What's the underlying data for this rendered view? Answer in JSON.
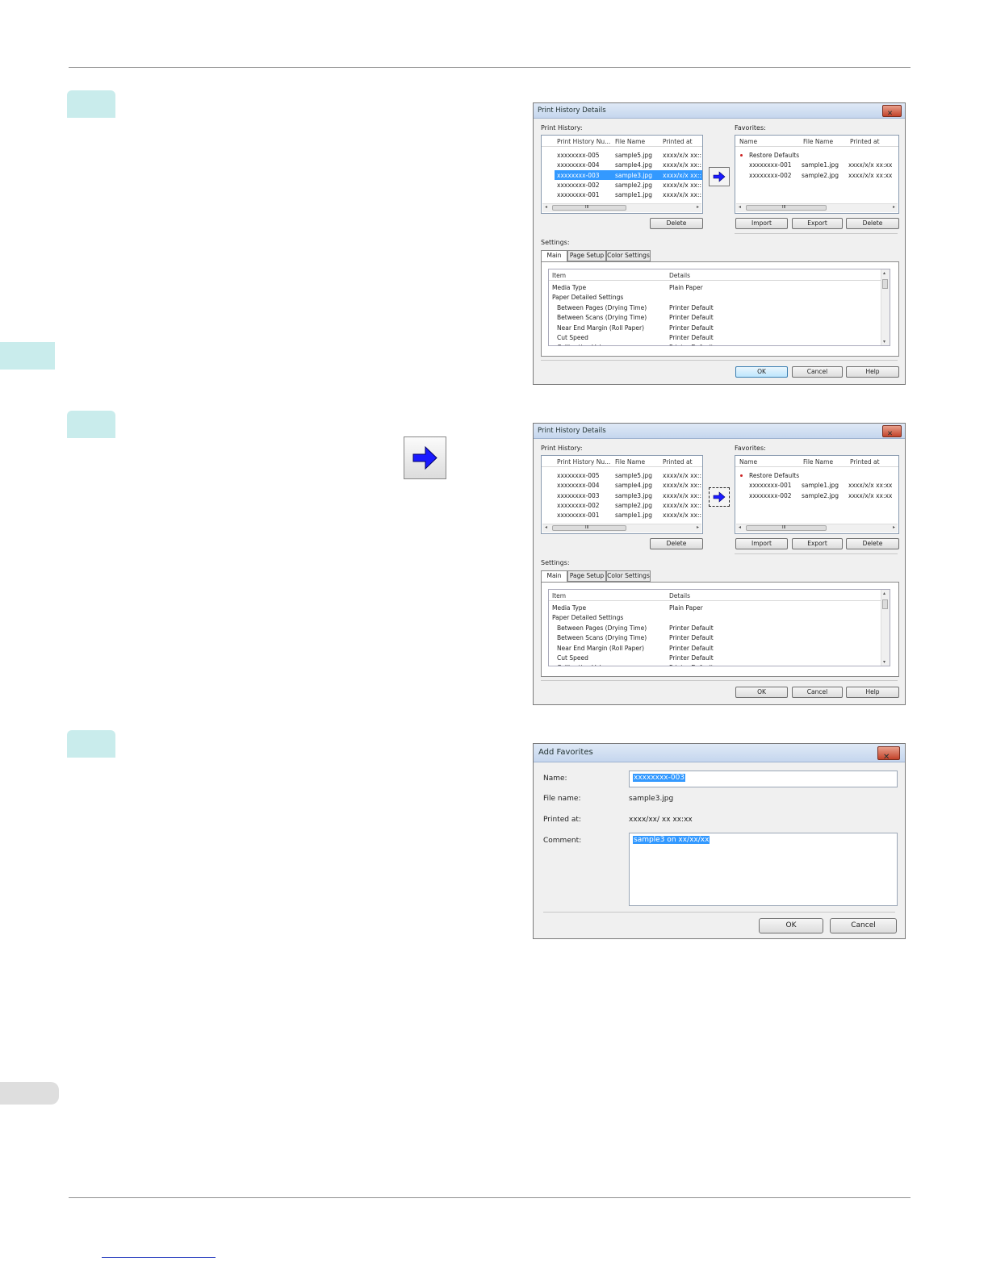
{
  "dialog1": {
    "title": "Print History Details",
    "print_history_label": "Print History:",
    "favorites_label": "Favorites:",
    "settings_label": "Settings:",
    "history_columns": [
      "Print History Nu...",
      "File Name",
      "Printed at"
    ],
    "history_rows": [
      [
        "xxxxxxxx-005",
        "sample5.jpg",
        "xxxx/x/x xx::"
      ],
      [
        "xxxxxxxx-004",
        "sample4.jpg",
        "xxxx/x/x xx::"
      ],
      [
        "xxxxxxxx-003",
        "sample3.jpg",
        "xxxx/x/x xx::"
      ],
      [
        "xxxxxxxx-002",
        "sample2.jpg",
        "xxxx/x/x xx::"
      ],
      [
        "xxxxxxxx-001",
        "sample1.jpg",
        "xxxx/x/x xx::"
      ]
    ],
    "favorites_columns": [
      "Name",
      "File Name",
      "Printed at"
    ],
    "favorites_rows": [
      [
        "Restore Defaults",
        "",
        ""
      ],
      [
        "xxxxxxxx-001",
        "sample1.jpg",
        "xxxx/x/x xx:xx"
      ],
      [
        "xxxxxxxx-002",
        "sample2.jpg",
        "xxxx/x/x xx:xx"
      ]
    ],
    "scroll_grip": "III",
    "delete_label": "Delete",
    "import_label": "Import",
    "export_label": "Export",
    "tabs": [
      "Main",
      "Page Setup",
      "Color Settings"
    ],
    "settings_columns": [
      "Item",
      "Details"
    ],
    "settings_rows": [
      [
        "Media Type",
        "Plain Paper"
      ],
      [
        "Paper Detailed Settings",
        ""
      ],
      [
        "Between Pages (Drying Time)",
        "Printer Default"
      ],
      [
        "Between Scans (Drying Time)",
        "Printer Default"
      ],
      [
        "Near End Margin (Roll Paper)",
        "Printer Default"
      ],
      [
        "Cut Speed",
        "Printer Default"
      ],
      [
        "Calibration Value",
        "Printer Default"
      ]
    ],
    "ok_label": "OK",
    "cancel_label": "Cancel",
    "help_label": "Help"
  },
  "add_favorites": {
    "title": "Add Favorites",
    "name_label": "Name:",
    "name_value": "xxxxxxxx-003",
    "file_name_label": "File name:",
    "file_name_value": "sample3.jpg",
    "printed_at_label": "Printed at:",
    "printed_at_value": "xxxx/xx/ xx xx:xx",
    "comment_label": "Comment:",
    "comment_value": "sample3 on xx/xx/xx",
    "ok_label": "OK",
    "cancel_label": "Cancel"
  },
  "colors": {
    "selection": "#3399ff",
    "step_tab": "#c9ecec",
    "arrow": "#1a1aff"
  }
}
